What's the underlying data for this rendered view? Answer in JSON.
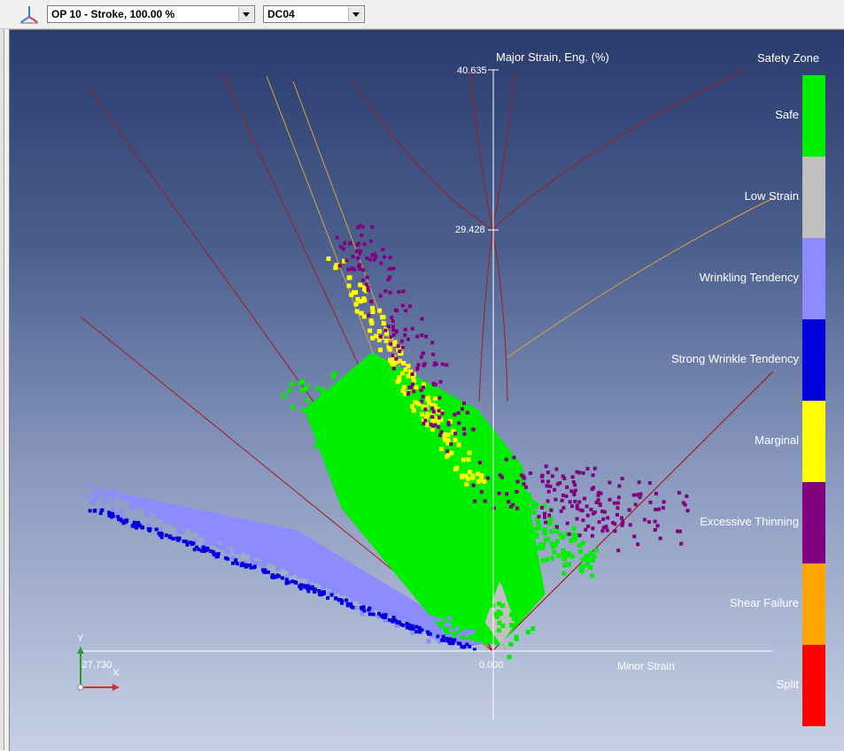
{
  "toolbar": {
    "stage_select": "OP 10 - Stroke, 100.00 %",
    "material_select": "DC04"
  },
  "chart_data": {
    "type": "scatter",
    "title": "Safety Zone",
    "ylabel": "Major Strain, Eng. (%)",
    "xlabel": "Minor Strain",
    "y_ticks": [
      "40.635",
      "29.428"
    ],
    "x_ticks": [
      "-27.730",
      "0.000"
    ],
    "axis_gizmo": {
      "y": "Y",
      "x": "X"
    },
    "legend": [
      {
        "name": "Safe",
        "color": "#00ee00"
      },
      {
        "name": "Low Strain",
        "color": "#c0c0c0"
      },
      {
        "name": "Wrinkling Tendency",
        "color": "#8c8cff"
      },
      {
        "name": "Strong Wrinkle Tendency",
        "color": "#0000dd"
      },
      {
        "name": "Marginal",
        "color": "#ffff00"
      },
      {
        "name": "Excessive Thinning",
        "color": "#800080"
      },
      {
        "name": "Shear Failure",
        "color": "#ffa500"
      },
      {
        "name": "Split",
        "color": "#ff0000"
      }
    ],
    "clusters": [
      {
        "name": "Strong Wrinkle Tendency",
        "x": [
          -27.0,
          -1.0
        ],
        "y": [
          11.3,
          0.0
        ]
      },
      {
        "name": "Wrinkling Tendency",
        "x": [
          -26.5,
          -0.5
        ],
        "y": [
          11.5,
          0.5
        ]
      },
      {
        "name": "Safe",
        "x": [
          -15.0,
          6.0
        ],
        "y": [
          20.0,
          0.0
        ]
      },
      {
        "name": "Marginal",
        "x": [
          -13.0,
          -1.0
        ],
        "y": [
          28.0,
          10.5
        ]
      },
      {
        "name": "Excessive Thinning",
        "x": [
          -12.0,
          13.0
        ],
        "y": [
          30.5,
          5.0
        ]
      }
    ]
  }
}
